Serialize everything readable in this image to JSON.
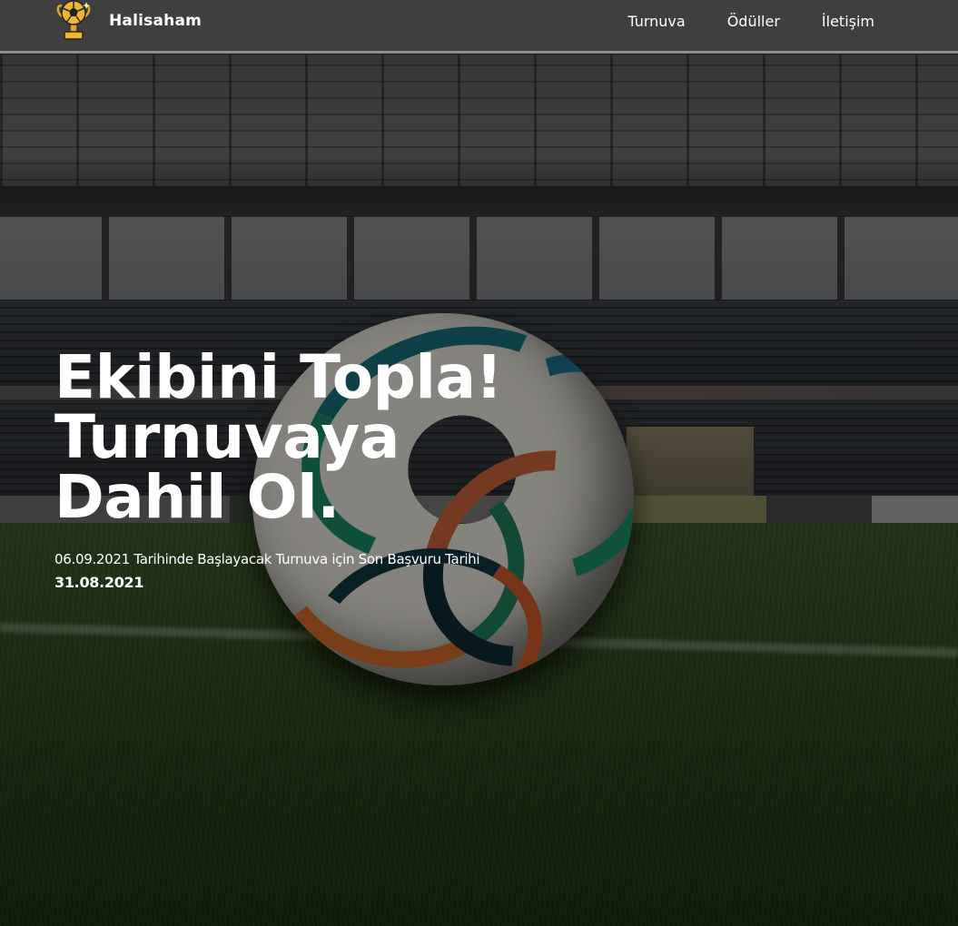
{
  "navbar": {
    "brand_name": "Halisaham",
    "logo_icon": "trophy-soccer-ball-icon",
    "links": [
      {
        "label": "Turnuva"
      },
      {
        "label": "Ödüller"
      },
      {
        "label": "İletişim"
      }
    ]
  },
  "hero": {
    "headline_line1": "Ekibini Topla!",
    "headline_line2": "Turnuvaya Dahil Ol.",
    "subtitle": "06.09.2021 Tarihinde Başlayacak Turnuva için Son Başvuru Tarihi",
    "deadline": "31.08.2021"
  },
  "colors": {
    "navbar_bg": "#3f3f3f",
    "text": "#ffffff",
    "trophy_gold": "#e0a526"
  }
}
